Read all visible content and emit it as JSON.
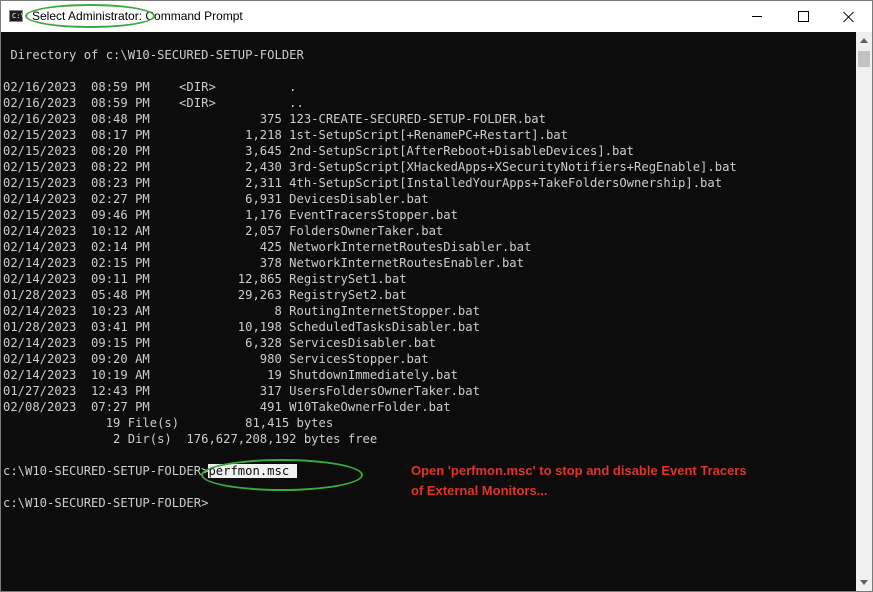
{
  "window": {
    "title": "Select Administrator: Command Prompt",
    "icon_text": "C:\\",
    "controls": {
      "minimize": "minimize-icon",
      "maximize": "maximize-icon",
      "close": "close-icon"
    }
  },
  "console": {
    "header": " Directory of c:\\W10-SECURED-SETUP-FOLDER",
    "entries": [
      "02/16/2023  08:59 PM    <DIR>          .",
      "02/16/2023  08:59 PM    <DIR>          ..",
      "02/16/2023  08:48 PM               375 123-CREATE-SECURED-SETUP-FOLDER.bat",
      "02/15/2023  08:17 PM             1,218 1st-SetupScript[+RenamePC+Restart].bat",
      "02/15/2023  08:20 PM             3,645 2nd-SetupScript[AfterReboot+DisableDevices].bat",
      "02/15/2023  08:22 PM             2,430 3rd-SetupScript[XHackedApps+XSecurityNotifiers+RegEnable].bat",
      "02/15/2023  08:23 PM             2,311 4th-SetupScript[InstalledYourApps+TakeFoldersOwnership].bat",
      "02/14/2023  02:27 PM             6,931 DevicesDisabler.bat",
      "02/15/2023  09:46 PM             1,176 EventTracersStopper.bat",
      "02/14/2023  10:12 AM             2,057 FoldersOwnerTaker.bat",
      "02/14/2023  02:14 PM               425 NetworkInternetRoutesDisabler.bat",
      "02/14/2023  02:15 PM               378 NetworkInternetRoutesEnabler.bat",
      "02/14/2023  09:11 PM            12,865 RegistrySet1.bat",
      "01/28/2023  05:48 PM            29,263 RegistrySet2.bat",
      "02/14/2023  10:23 AM                 8 RoutingInternetStopper.bat",
      "01/28/2023  03:41 PM            10,198 ScheduledTasksDisabler.bat",
      "02/14/2023  09:15 PM             6,328 ServicesDisabler.bat",
      "02/14/2023  09:20 AM               980 ServicesStopper.bat",
      "02/14/2023  10:19 AM                19 ShutdownImmediately.bat",
      "01/27/2023  12:43 PM               317 UsersFoldersOwnerTaker.bat",
      "02/08/2023  07:27 PM               491 W10TakeOwnerFolder.bat"
    ],
    "summary_files": "              19 File(s)         81,415 bytes",
    "summary_dirs": "               2 Dir(s)  176,627,208,192 bytes free",
    "prompt": "c:\\W10-SECURED-SETUP-FOLDER>",
    "command": "perfmon.msc ",
    "prompt2": "c:\\W10-SECURED-SETUP-FOLDER>"
  },
  "annotation": {
    "line1": "Open 'perfmon.msc' to stop and disable Event Tracers",
    "line2": "of External Monitors...",
    "color": "#e0342b"
  },
  "colors": {
    "console_bg": "#0c0c0c",
    "console_text": "#cccccc",
    "highlight_ellipse": "#3daa3d"
  }
}
